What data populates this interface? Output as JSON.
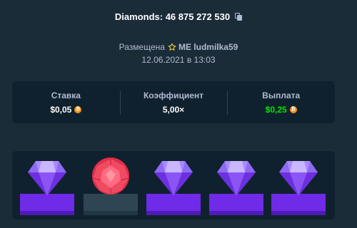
{
  "header": {
    "game_title": "Diamonds: 46 875 272 530",
    "placed_label": "Размещена",
    "username": "ME ludmilka59",
    "date": "12.06.2021 в 13:03"
  },
  "stats": [
    {
      "label": "Ставка",
      "value": "$0,05",
      "currency": "btc-coin-icon"
    },
    {
      "label": "Коэффициент",
      "value": "5,00×"
    },
    {
      "label": "Выплата",
      "value": "$0,25",
      "currency": "btc-coin-icon",
      "color": "#00e701"
    }
  ],
  "gems": [
    {
      "type": "diamond",
      "color": "purple",
      "matched": true
    },
    {
      "type": "ruby",
      "color": "red",
      "matched": false
    },
    {
      "type": "diamond",
      "color": "purple",
      "matched": true
    },
    {
      "type": "diamond",
      "color": "purple",
      "matched": true
    },
    {
      "type": "diamond",
      "color": "purple",
      "matched": true
    }
  ],
  "colors": {
    "background": "#1a2c38",
    "panel": "#0f212e",
    "accent_purple": "#6f2be8",
    "payout_green": "#00e701",
    "coin": "#f7931a"
  }
}
